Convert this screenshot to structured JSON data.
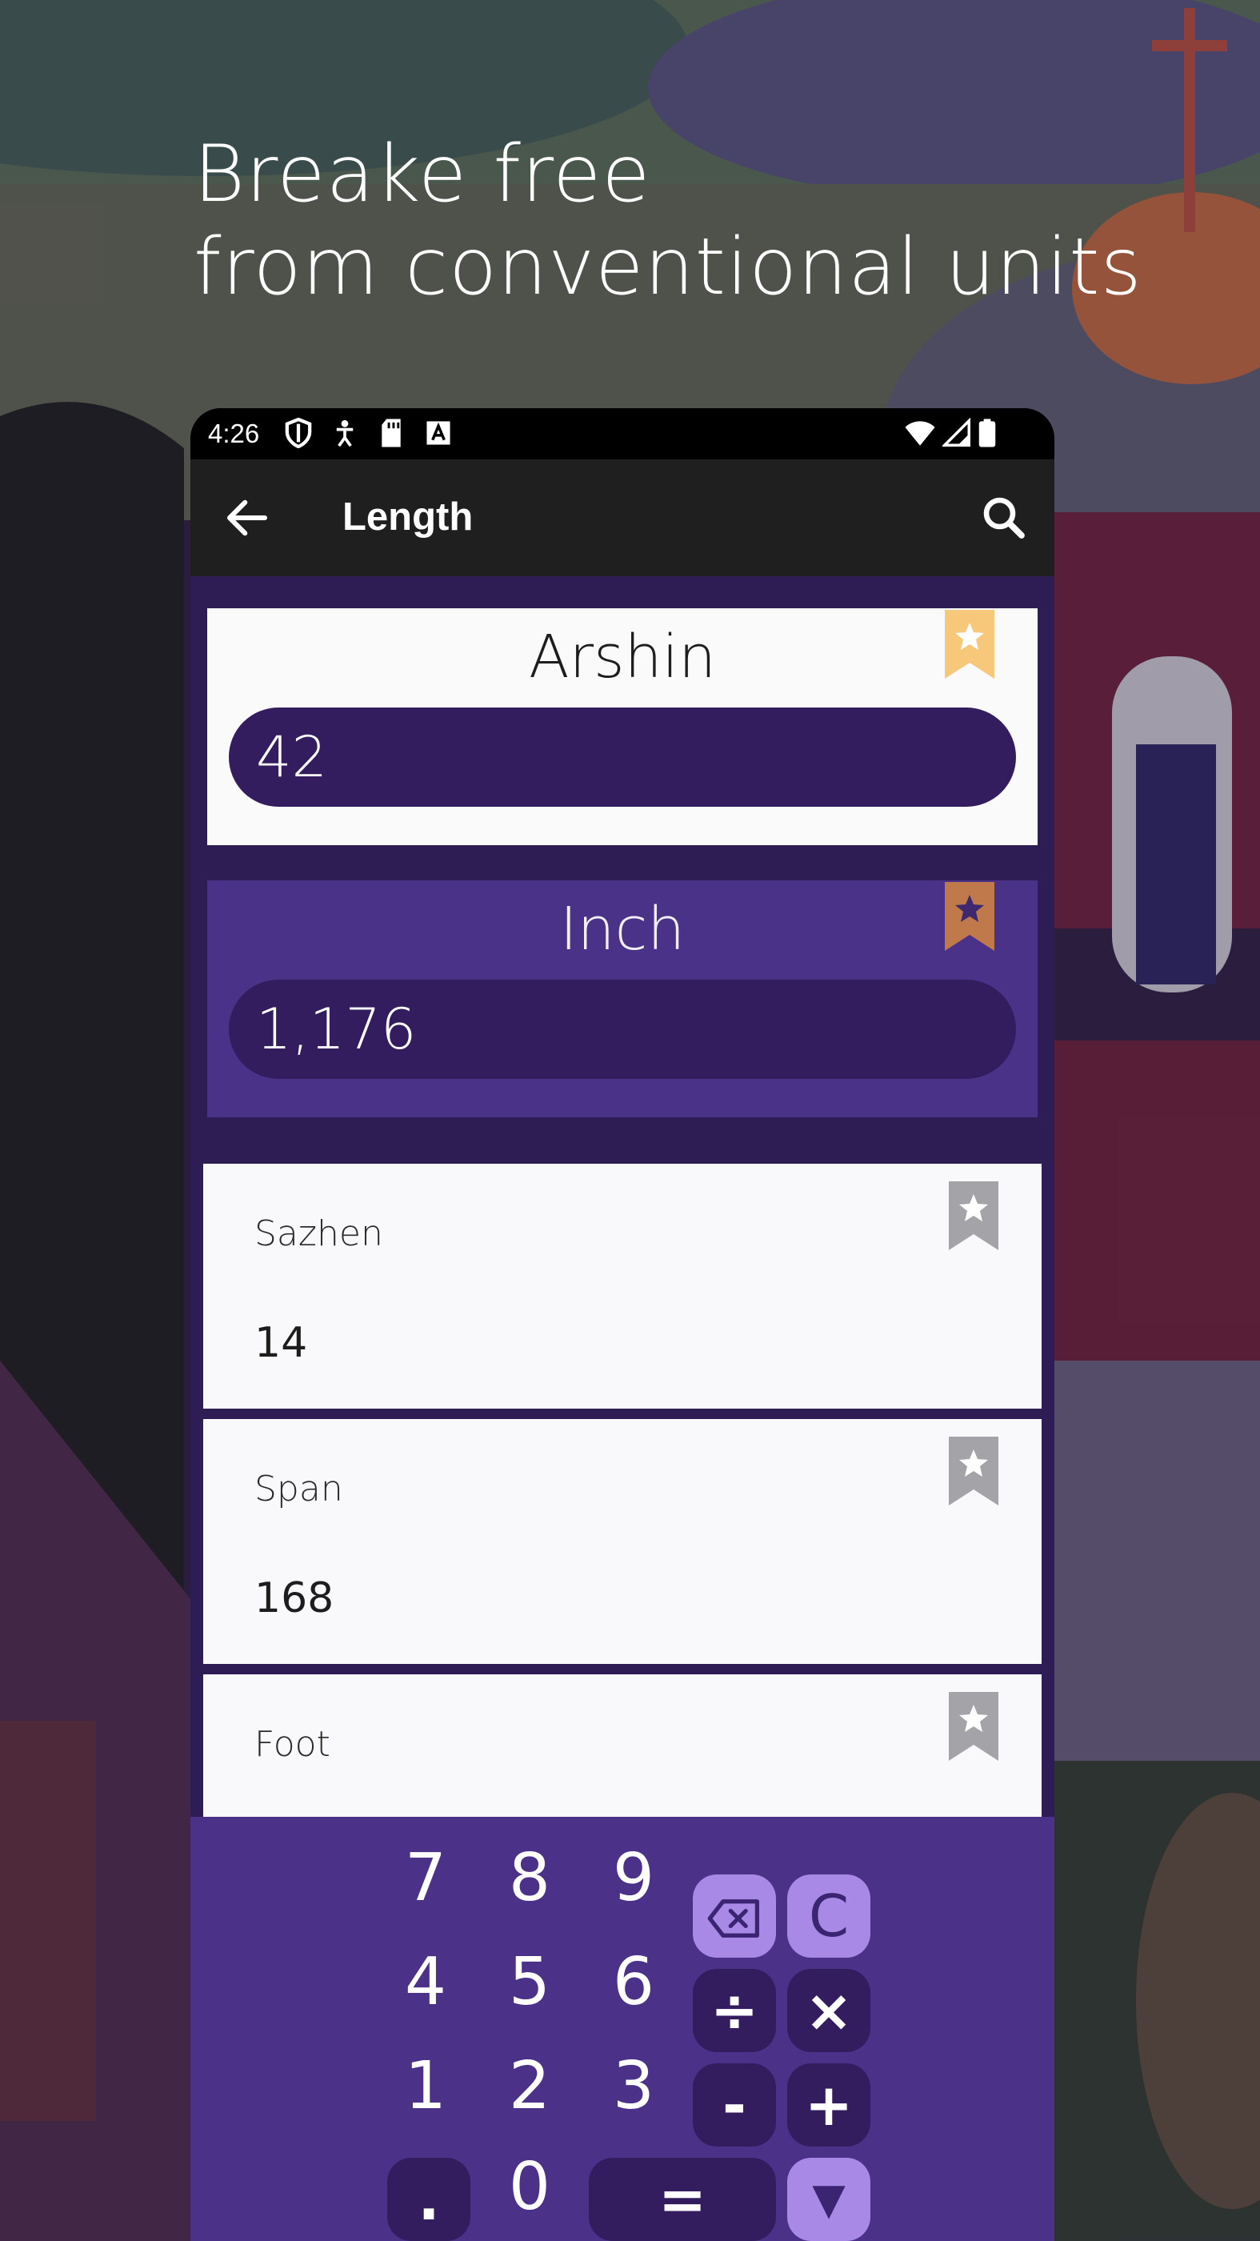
{
  "headline": {
    "line1": "Breake free",
    "line2": "from conventional units"
  },
  "status_bar": {
    "time": "4:26",
    "icons": [
      "shield-icon",
      "accessibility-icon",
      "sd-card-icon",
      "keyboard-a-icon",
      "wifi-icon",
      "signal-icon",
      "battery-icon"
    ]
  },
  "app_bar": {
    "title": "Length",
    "back_icon": "arrow-left-icon",
    "search_icon": "search-icon"
  },
  "main_units": [
    {
      "name": "Arshin",
      "value": "42",
      "bookmark": "bookmark-star-icon",
      "bookmark_color": "#f7c77a"
    },
    {
      "name": "Inch",
      "value": "1,176",
      "bookmark": "bookmark-star-icon",
      "bookmark_color": "#c0794b"
    }
  ],
  "unit_list": [
    {
      "name": "Sazhen",
      "value": "14"
    },
    {
      "name": "Span",
      "value": "168"
    },
    {
      "name": "Foot",
      "value": ""
    }
  ],
  "keypad": {
    "digits": [
      "7",
      "8",
      "9",
      "4",
      "5",
      "6",
      "1",
      "2",
      "3",
      ".",
      "0"
    ],
    "ops": {
      "backspace": "⌫",
      "clear": "C",
      "divide": "÷",
      "multiply": "×",
      "minus": "-",
      "plus": "+",
      "equals": "=",
      "collapse": "▼"
    }
  },
  "colors": {
    "accent_purple": "#4b3288",
    "dark_purple": "#341d5e",
    "light_purple": "#a88ae6",
    "app_bar": "#1f1f1f"
  }
}
